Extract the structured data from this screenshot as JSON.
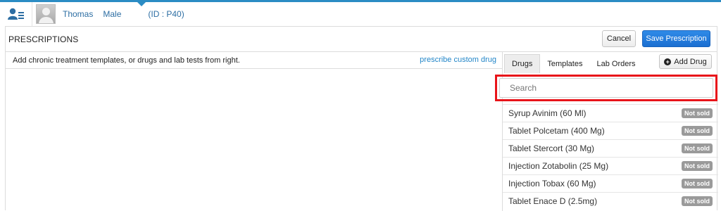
{
  "header": {
    "patient_name": "Thomas",
    "patient_gender": "Male",
    "patient_id": "(ID : P40)"
  },
  "panel": {
    "title": "PRESCRIPTIONS",
    "cancel_label": "Cancel",
    "save_label": "Save Prescription"
  },
  "left": {
    "hint": "Add chronic treatment templates, or drugs and lab tests from right.",
    "custom_link": "prescribe custom drug"
  },
  "right": {
    "tabs": [
      {
        "label": "Drugs",
        "active": true
      },
      {
        "label": "Templates",
        "active": false
      },
      {
        "label": "Lab Orders",
        "active": false
      }
    ],
    "add_drug_label": "Add Drug",
    "search_placeholder": "Search",
    "drugs": [
      {
        "name": "Syrup Avinim (60 Ml)",
        "badge": "Not sold"
      },
      {
        "name": "Tablet Polcetam (400 Mg)",
        "badge": "Not sold"
      },
      {
        "name": "Tablet Stercort (30 Mg)",
        "badge": "Not sold"
      },
      {
        "name": "Injection Zotabolin (25 Mg)",
        "badge": "Not sold"
      },
      {
        "name": "Injection Tobax (60 Mg)",
        "badge": "Not sold"
      },
      {
        "name": "Tablet Enace D (2.5mg)",
        "badge": "Not sold"
      }
    ]
  },
  "colors": {
    "accent": "#2b8cc4",
    "primary_button": "#1b6fd1",
    "highlight_border": "#e8141a",
    "badge": "#9a9a9a"
  }
}
